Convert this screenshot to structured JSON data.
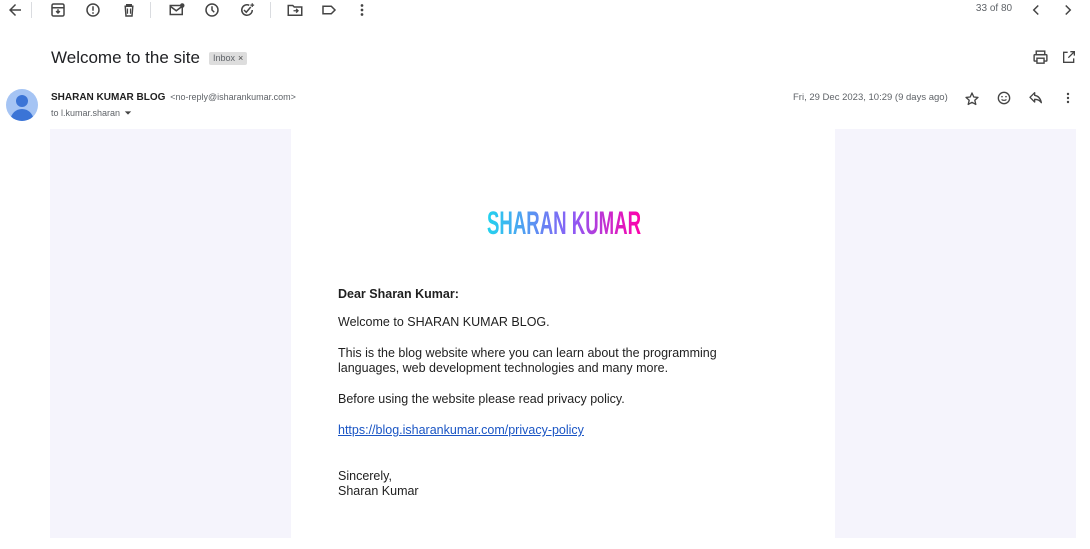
{
  "toolbar": {
    "counter": "33 of 80"
  },
  "message": {
    "subject": "Welcome to the site",
    "label": "Inbox",
    "label_remove": "×",
    "sender_name": "SHARAN KUMAR BLOG",
    "sender_email": "<no-reply@isharankumar.com>",
    "recipient": "to l.kumar.sharan",
    "date": "Fri, 29 Dec 2023, 10:29 (9 days ago)"
  },
  "body": {
    "logo_text": "SHARAN KUMAR",
    "greeting": "Dear Sharan Kumar:",
    "welcome": "Welcome to SHARAN KUMAR BLOG.",
    "description_line1": "This is the blog website where you can learn about the programming",
    "description_line2": "languages, web development technologies and many more.",
    "privacy_note": "Before using the website please read privacy policy.",
    "privacy_link": "https://blog.isharankumar.com/privacy-policy",
    "closing": "Sincerely,",
    "signature": "Sharan Kumar"
  },
  "colors": {
    "link": "#1a55c4",
    "canvas": "#f5f4fc",
    "avatar": "#a5c4f4",
    "logo_gradient": [
      "#22d3ee",
      "#a855f7",
      "#ff00aa"
    ]
  },
  "icons": [
    "back-arrow-icon",
    "archive-icon",
    "report-spam-icon",
    "delete-icon",
    "mark-unread-icon",
    "snooze-icon",
    "add-task-icon",
    "move-to-icon",
    "label-icon",
    "more-vert-icon",
    "chevron-left-icon",
    "chevron-right-icon",
    "print-icon",
    "open-new-window-icon",
    "star-icon",
    "emoji-icon",
    "reply-icon",
    "more-vert-icon"
  ]
}
